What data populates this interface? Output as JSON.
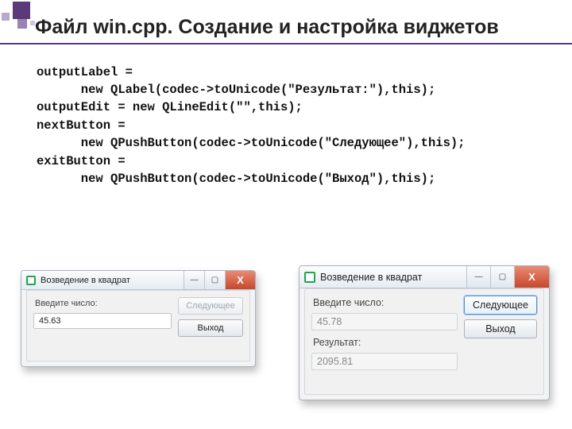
{
  "title": "Файл win.cpp. Создание и настройка виджетов",
  "code": "outputLabel =\n      new QLabel(codec->toUnicode(\"Результат:\"),this);\noutputEdit = new QLineEdit(\"\",this);\nnextButton =\n      new QPushButton(codec->toUnicode(\"Следующее\"),this);\nexitButton =\n      new QPushButton(codec->toUnicode(\"Выход\"),this);",
  "window_common": {
    "title": "Возведение в квадрат",
    "min_glyph": "—",
    "max_glyph": "▢",
    "close_glyph": "X",
    "input_label": "Введите число:",
    "next_label": "Следующее",
    "exit_label": "Выход",
    "result_label": "Результат:"
  },
  "windowA": {
    "input_value": "45.63"
  },
  "windowB": {
    "input_value": "45.78",
    "result_value": "2095.81"
  }
}
